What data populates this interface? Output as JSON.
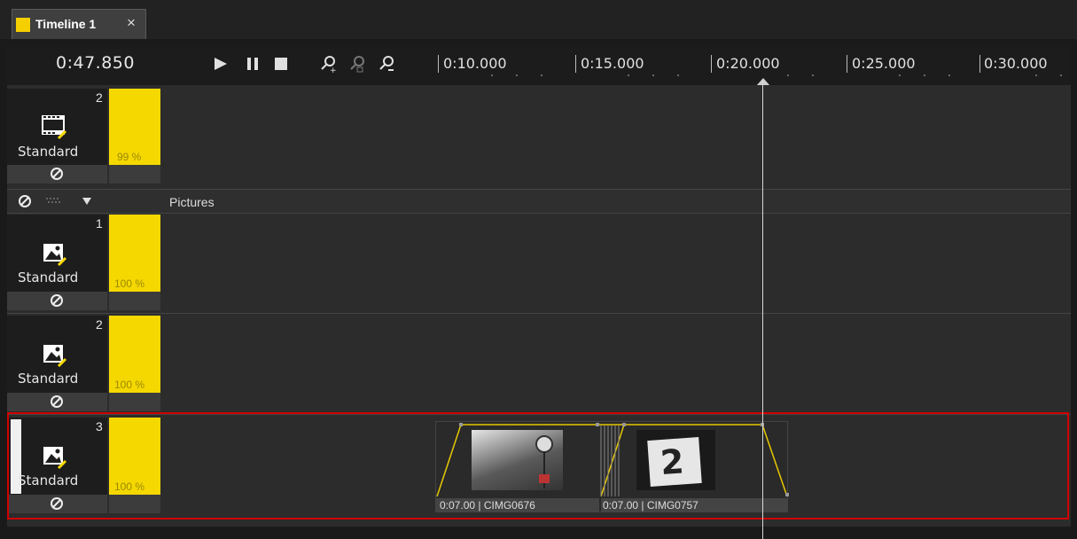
{
  "tab": {
    "title": "Timeline 1",
    "close": "×"
  },
  "toolbar": {
    "time": "0:47.850",
    "ticks": [
      "0:10.000",
      "0:15.000",
      "0:20.000",
      "0:25.000",
      "0:30.000"
    ]
  },
  "tracks": [
    {
      "number": "2",
      "label": "Standard",
      "percent": "99 %"
    },
    {
      "number": "1",
      "label": "Standard",
      "percent": "100 %"
    },
    {
      "number": "2",
      "label": "Standard",
      "percent": "100 %"
    },
    {
      "number": "3",
      "label": "Standard",
      "percent": "100 %"
    }
  ],
  "group": {
    "name": "Pictures"
  },
  "clips": [
    {
      "caption": "0:07.00 | CIMG0676"
    },
    {
      "caption": "0:07.00 | CIMG0757",
      "frame_text": "2"
    }
  ],
  "colors": {
    "accent": "#f5d800",
    "selection": "#d00000"
  }
}
